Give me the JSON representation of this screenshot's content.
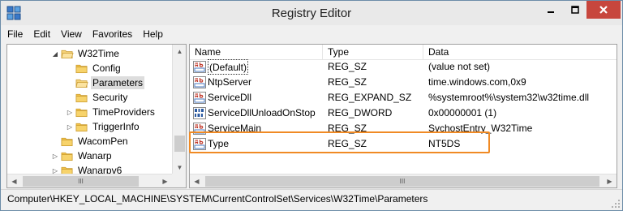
{
  "window": {
    "title": "Registry Editor"
  },
  "menu": [
    "File",
    "Edit",
    "View",
    "Favorites",
    "Help"
  ],
  "tree": {
    "items": [
      {
        "label": "W32Time",
        "arrow": "◢",
        "icon": "folder-open-icon"
      },
      {
        "label": "Config",
        "arrow": "",
        "icon": "folder-icon"
      },
      {
        "label": "Parameters",
        "arrow": "",
        "icon": "folder-open-icon",
        "selected": true
      },
      {
        "label": "Security",
        "arrow": "",
        "icon": "folder-icon"
      },
      {
        "label": "TimeProviders",
        "arrow": "▷",
        "icon": "folder-icon"
      },
      {
        "label": "TriggerInfo",
        "arrow": "▷",
        "icon": "folder-icon"
      },
      {
        "label": "WacomPen",
        "arrow": "",
        "icon": "folder-icon"
      },
      {
        "label": "Wanarp",
        "arrow": "▷",
        "icon": "folder-icon"
      },
      {
        "label": "Wanarpv6",
        "arrow": "▷",
        "icon": "folder-icon"
      }
    ],
    "scroll_thumb_glyph": "III"
  },
  "list": {
    "columns": [
      "Name",
      "Type",
      "Data"
    ],
    "rows": [
      {
        "name": "(Default)",
        "type": "REG_SZ",
        "data": "(value not set)",
        "icon": "string-value-icon",
        "focused": true
      },
      {
        "name": "NtpServer",
        "type": "REG_SZ",
        "data": "time.windows.com,0x9",
        "icon": "string-value-icon"
      },
      {
        "name": "ServiceDll",
        "type": "REG_EXPAND_SZ",
        "data": "%systemroot%\\system32\\w32time.dll",
        "icon": "string-value-icon"
      },
      {
        "name": "ServiceDllUnloadOnStop",
        "type": "REG_DWORD",
        "data": "0x00000001 (1)",
        "icon": "binary-value-icon"
      },
      {
        "name": "ServiceMain",
        "type": "REG_SZ",
        "data": "SvchostEntry_W32Time",
        "icon": "string-value-icon"
      },
      {
        "name": "Type",
        "type": "REG_SZ",
        "data": "NT5DS",
        "icon": "string-value-icon",
        "highlighted": true
      }
    ],
    "scroll_thumb_glyph": "III"
  },
  "status": {
    "path": "Computer\\HKEY_LOCAL_MACHINE\\SYSTEM\\CurrentControlSet\\Services\\W32Time\\Parameters"
  },
  "colors": {
    "highlight_border": "#f08a24",
    "close_button": "#c7463d",
    "string_icon_red": "#c0392b",
    "binary_icon_blue": "#2c5aa0"
  }
}
